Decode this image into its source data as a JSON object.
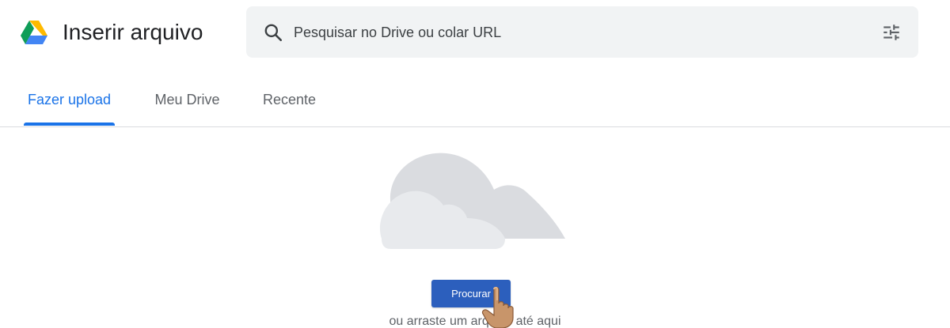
{
  "header": {
    "logo_icon": "google-drive-logo",
    "title": "Inserir arquivo",
    "search": {
      "placeholder": "Pesquisar no Drive ou colar URL",
      "search_icon": "search-icon",
      "options_icon": "tune-icon"
    }
  },
  "tabs": [
    {
      "label": "Fazer upload",
      "active": true
    },
    {
      "label": "Meu Drive",
      "active": false
    },
    {
      "label": "Recente",
      "active": false
    }
  ],
  "upload": {
    "illustration_icon": "cloud-icon",
    "browse_label": "Procurar",
    "drop_hint": "ou arraste um arquivo até aqui",
    "cursor_icon": "hand-pointer-icon"
  },
  "colors": {
    "accent": "#1a73e8",
    "button": "#2c5fbd",
    "search_bg": "#f1f3f4",
    "cloud": "#dadce0"
  }
}
